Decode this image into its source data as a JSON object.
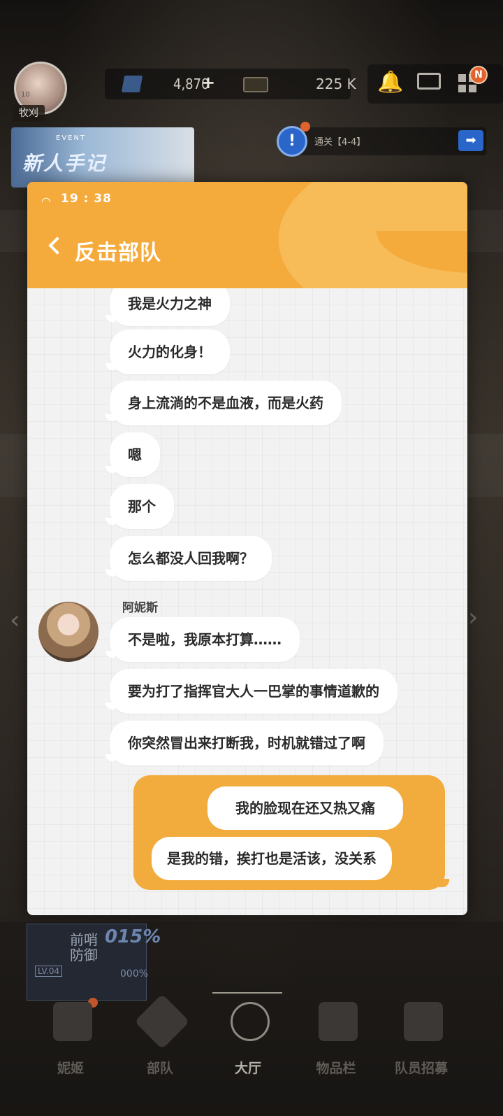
{
  "hud": {
    "player_level": "10",
    "player_name": "牧刈",
    "resource_1": "4,870",
    "resource_1_add": "+",
    "resource_2": "225 K",
    "badge": "N"
  },
  "event_banner": {
    "tag": "EVENT",
    "title": "新人手记"
  },
  "mission": {
    "icon": "!",
    "text": "通关【4-4】",
    "arrow": "➡"
  },
  "chat": {
    "status_time": "19 : 38",
    "title": "反击部队",
    "incoming_block_1": [
      "我是火力之神",
      "火力的化身！",
      "身上流淌的不是血液，而是火药",
      "嗯",
      "那个",
      "怎么都没人回我啊？"
    ],
    "sender_name": "阿妮斯",
    "incoming_block_2": [
      "不是啦，我原本打算……",
      "要为打了指挥官大人一巴掌的事情道歉的",
      "你突然冒出来打断我，时机就错过了啊"
    ],
    "reply_options": [
      "我的脸现在还又热又痛",
      "是我的错，挨打也是活该，没关系"
    ]
  },
  "defense": {
    "title": "前哨防御",
    "percent": "015%",
    "level": "LV.04",
    "percent_2": "000%"
  },
  "nav": {
    "items": [
      "妮姬",
      "部队",
      "大厅",
      "物品栏",
      "队员招募"
    ],
    "active": "大厅"
  },
  "colors": {
    "accent": "#f5ab3c",
    "panel_bg": "#f2f2f2",
    "badge": "#e0622c",
    "mission_blue": "#2a66c9"
  }
}
